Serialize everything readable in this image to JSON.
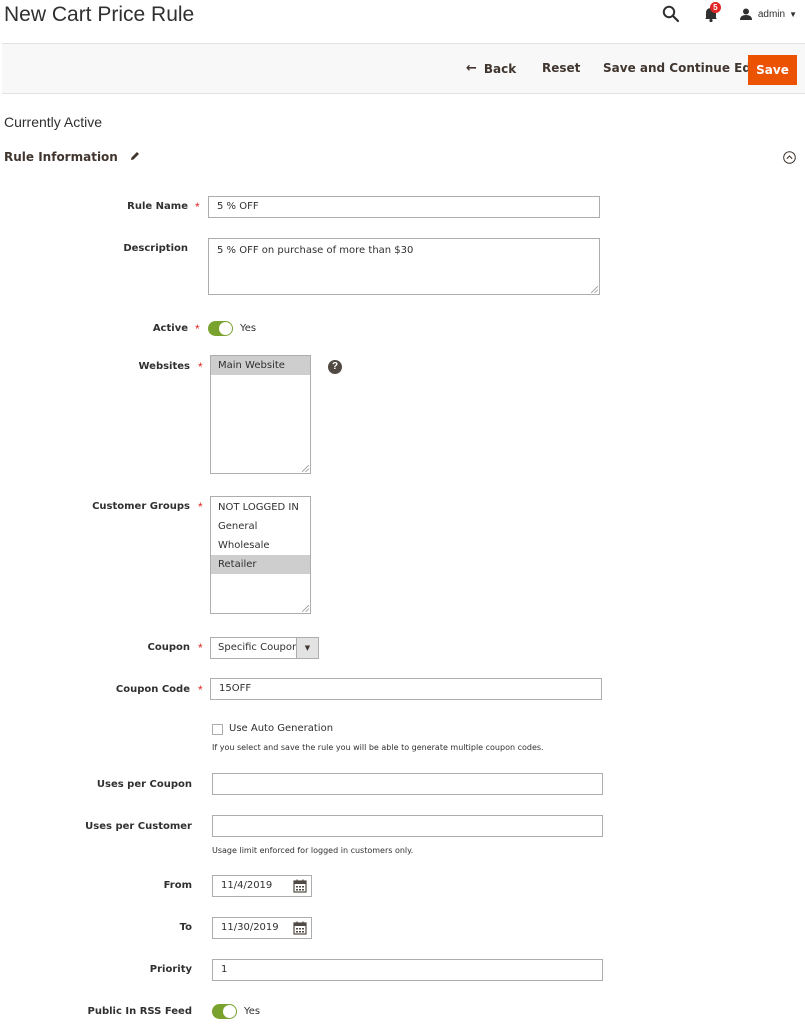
{
  "page": {
    "title": "New Cart Price Rule"
  },
  "header": {
    "search_icon": "search-icon",
    "notifications_count": "5",
    "user_name": "admin"
  },
  "toolbar": {
    "back_label": "Back",
    "reset_label": "Reset",
    "save_continue_label": "Save and Continue Edit",
    "save_label": "Save"
  },
  "status": "Currently Active",
  "section": {
    "title": "Rule Information"
  },
  "form": {
    "rule_name": {
      "label": "Rule Name",
      "value": "5  % OFF"
    },
    "description": {
      "label": "Description",
      "value": "5  % OFF on purchase of more than $30"
    },
    "active": {
      "label": "Active",
      "value": "Yes",
      "on": true
    },
    "websites": {
      "label": "Websites",
      "options": [
        "Main Website"
      ],
      "selected": [
        "Main Website"
      ]
    },
    "customer_groups": {
      "label": "Customer Groups",
      "options": [
        "NOT LOGGED IN",
        "General",
        "Wholesale",
        "Retailer"
      ],
      "selected": [
        "Retailer"
      ]
    },
    "coupon": {
      "label": "Coupon",
      "value": "Specific Coupon"
    },
    "coupon_code": {
      "label": "Coupon Code",
      "value": "15OFF"
    },
    "auto_generation": {
      "label": "Use Auto Generation",
      "checked": false,
      "note": "If you select and save the rule you will be able to generate multiple coupon codes."
    },
    "uses_per_coupon": {
      "label": "Uses per Coupon",
      "value": ""
    },
    "uses_per_customer": {
      "label": "Uses per Customer",
      "value": "",
      "note": "Usage limit enforced for logged in customers only."
    },
    "from": {
      "label": "From",
      "value": "11/4/2019"
    },
    "to": {
      "label": "To",
      "value": "11/30/2019"
    },
    "priority": {
      "label": "Priority",
      "value": "1"
    },
    "public_rss": {
      "label": "Public In RSS Feed",
      "value": "Yes",
      "on": true
    }
  },
  "colors": {
    "accent": "#eb5202",
    "switch_on": "#79a22e",
    "required": "#e02b27",
    "badge": "#e22626"
  }
}
